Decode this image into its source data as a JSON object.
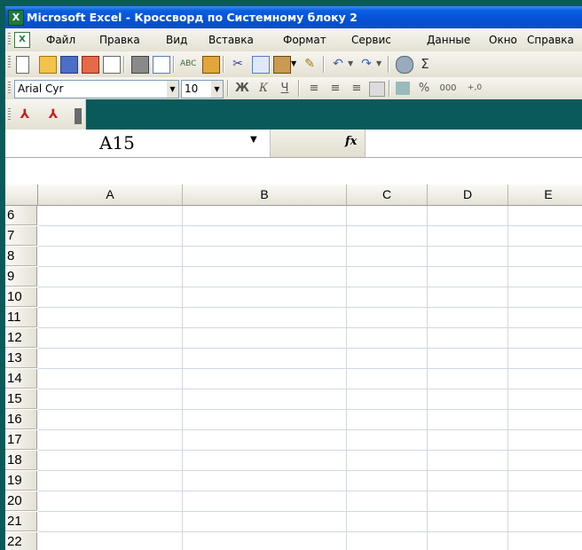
{
  "window": {
    "title": "Microsoft Excel - Кроссворд по Системному блоку 2",
    "app_icon": "excel-icon"
  },
  "menu": {
    "items": [
      "Файл",
      "Правка",
      "Вид",
      "Вставка",
      "Формат",
      "Сервис",
      "Данные",
      "Окно",
      "Справка"
    ]
  },
  "toolbar": {
    "buttons": [
      "new-icon",
      "open-icon",
      "save-icon",
      "permission-icon",
      "print-icon",
      "print-preview-icon",
      "spelling-icon",
      "research-icon",
      "cut-icon",
      "copy-icon",
      "paste-icon",
      "format-painter-icon",
      "undo-icon",
      "redo-icon",
      "hyperlink-icon",
      "autosum-icon"
    ]
  },
  "format": {
    "font_name": "Arial Cyr",
    "font_size": "10",
    "bold_label": "Ж",
    "italic_label": "К",
    "underline_label": "Ч",
    "percent_label": "%",
    "thousands_label": "000",
    "increase_decimal_label": "+,0"
  },
  "formula_bar": {
    "name_box": "A15",
    "fx_label": "fx",
    "formula": ""
  },
  "grid": {
    "columns": [
      "A",
      "B",
      "C",
      "D",
      "E"
    ],
    "rows": [
      "6",
      "7",
      "8",
      "9",
      "10",
      "11",
      "12",
      "13",
      "14",
      "15",
      "16",
      "17",
      "18",
      "19",
      "20",
      "21",
      "22"
    ]
  },
  "colors": {
    "desktop": "#0b5a5a",
    "titlebar": "#0552d6",
    "gridline": "#d0d7e5"
  }
}
